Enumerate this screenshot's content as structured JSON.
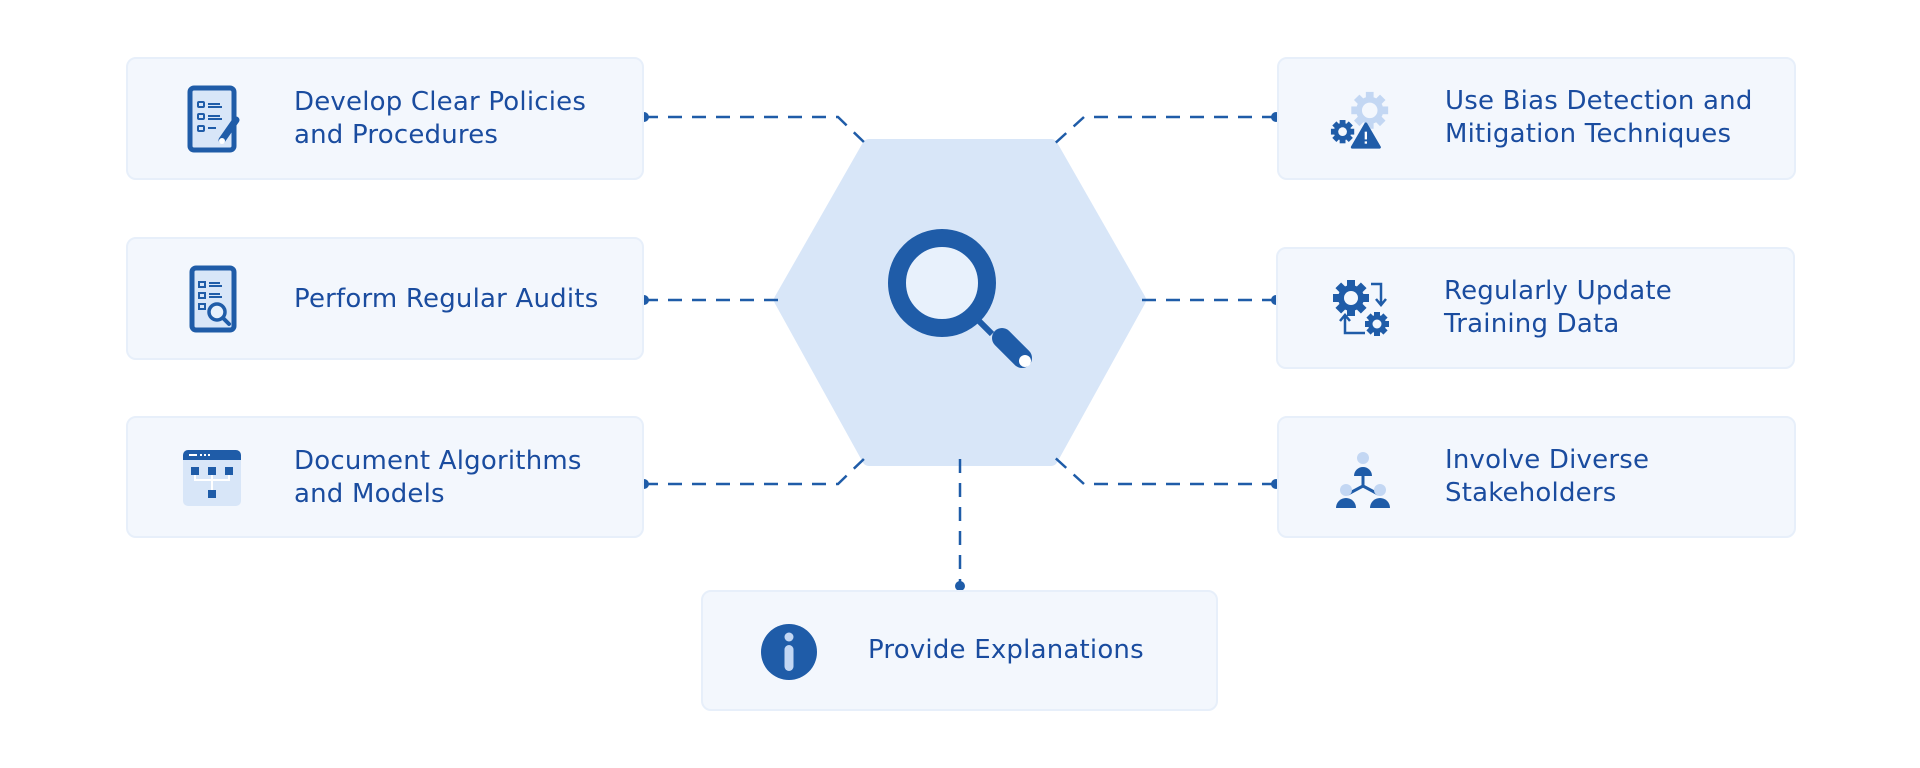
{
  "center": {
    "icon": "magnifier-icon"
  },
  "items": [
    {
      "id": "develop-policies",
      "label_lines": [
        "Develop Clear Policies",
        "and Procedures"
      ],
      "icon": "checklist-pen-icon",
      "side": "left"
    },
    {
      "id": "perform-audits",
      "label_lines": [
        "Perform Regular Audits"
      ],
      "icon": "audit-checklist-icon",
      "side": "left"
    },
    {
      "id": "document-algorithms",
      "label_lines": [
        "Document Algorithms",
        "and Models"
      ],
      "icon": "flowchart-window-icon",
      "side": "left"
    },
    {
      "id": "bias-detection",
      "label_lines": [
        "Use Bias Detection and",
        "Mitigation Techniques"
      ],
      "icon": "gear-warning-icon",
      "side": "right"
    },
    {
      "id": "update-training-data",
      "label_lines": [
        "Regularly Update",
        "Training Data"
      ],
      "icon": "gears-refresh-icon",
      "side": "right"
    },
    {
      "id": "diverse-stakeholders",
      "label_lines": [
        "Involve Diverse",
        "Stakeholders"
      ],
      "icon": "people-network-icon",
      "side": "right"
    },
    {
      "id": "provide-explanations",
      "label_lines": [
        "Provide Explanations"
      ],
      "icon": "info-icon",
      "side": "bottom"
    }
  ],
  "colors": {
    "primary": "#1f5ca8",
    "text": "#1a4c9f",
    "light": "#d8e6f8",
    "box_bg": "#f3f7fd",
    "icon_light": "#c3d7f3"
  }
}
